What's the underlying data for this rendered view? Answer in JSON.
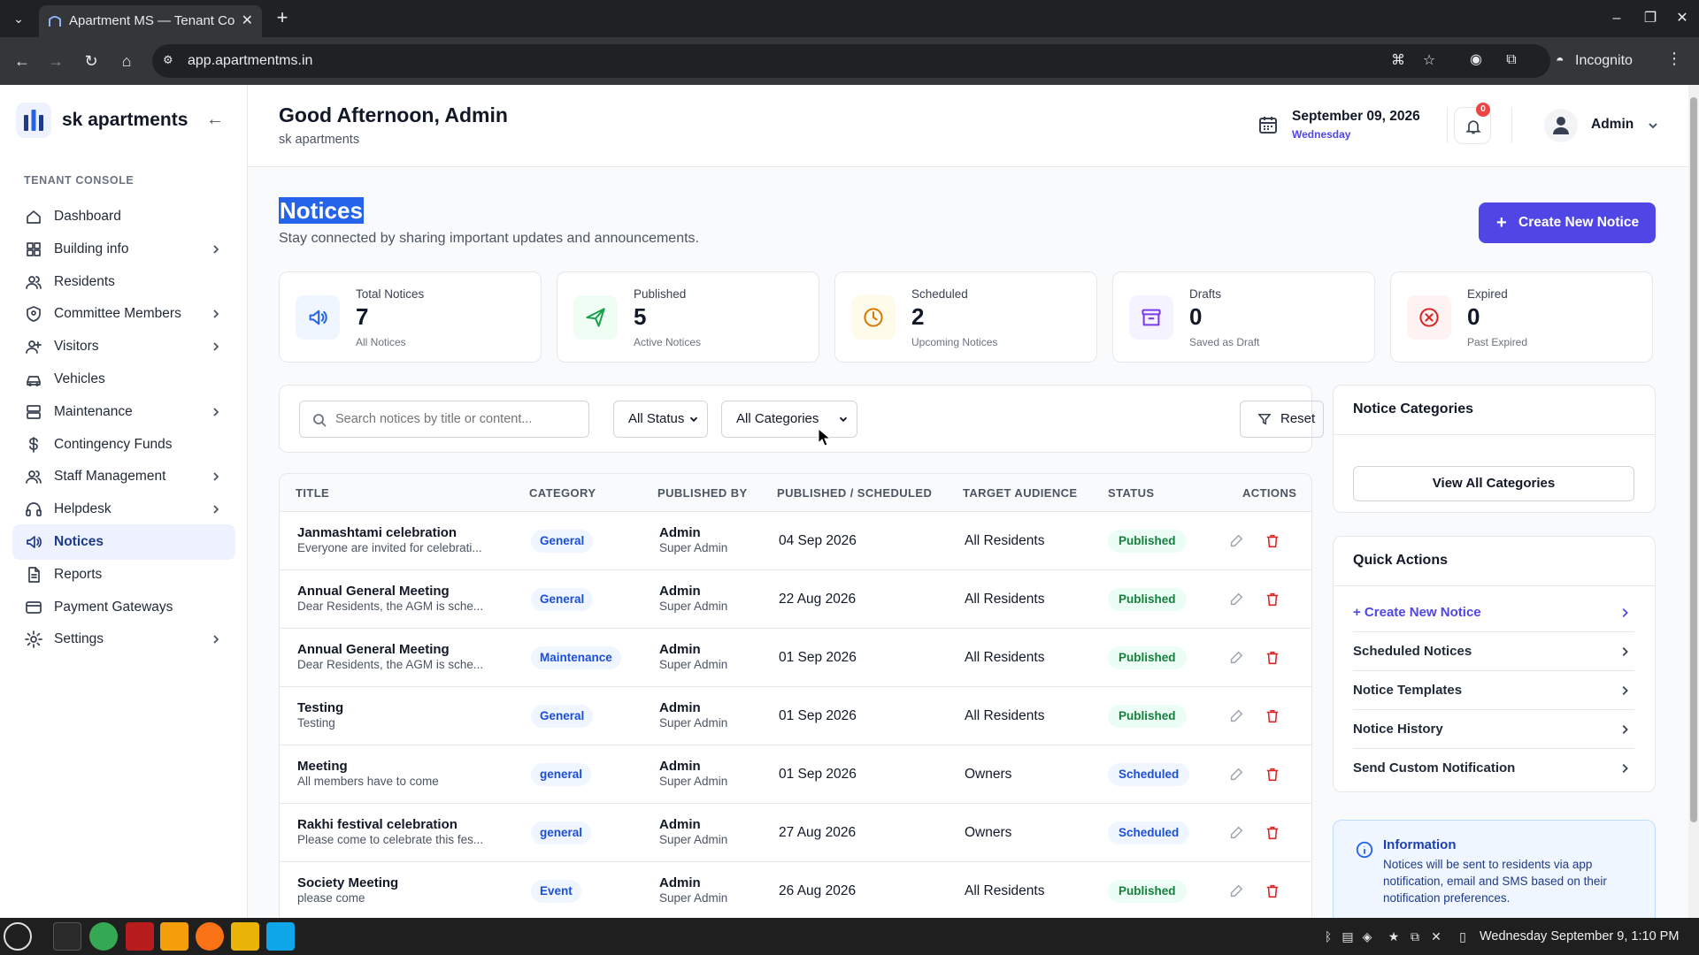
{
  "browser": {
    "tab_title": "Apartment MS — Tenant Co",
    "url": "app.apartmentms.in",
    "profile_label": "Incognito"
  },
  "sidebar": {
    "brand": "sk apartments",
    "section_label": "TENANT CONSOLE",
    "items": [
      {
        "label": "Dashboard",
        "icon": "home-icon",
        "has_submenu": false,
        "active": false
      },
      {
        "label": "Building info",
        "icon": "grid-icon",
        "has_submenu": true,
        "active": false
      },
      {
        "label": "Residents",
        "icon": "users-icon",
        "has_submenu": false,
        "active": false
      },
      {
        "label": "Committee Members",
        "icon": "shield-icon",
        "has_submenu": true,
        "active": false
      },
      {
        "label": "Visitors",
        "icon": "user-plus-icon",
        "has_submenu": true,
        "active": false
      },
      {
        "label": "Vehicles",
        "icon": "car-icon",
        "has_submenu": false,
        "active": false
      },
      {
        "label": "Maintenance",
        "icon": "server-icon",
        "has_submenu": true,
        "active": false
      },
      {
        "label": "Contingency Funds",
        "icon": "dollar-icon",
        "has_submenu": false,
        "active": false
      },
      {
        "label": "Staff Management",
        "icon": "staff-icon",
        "has_submenu": true,
        "active": false
      },
      {
        "label": "Helpdesk",
        "icon": "headset-icon",
        "has_submenu": true,
        "active": false
      },
      {
        "label": "Notices",
        "icon": "megaphone-icon",
        "has_submenu": false,
        "active": true
      },
      {
        "label": "Reports",
        "icon": "file-icon",
        "has_submenu": false,
        "active": false
      },
      {
        "label": "Payment Gateways",
        "icon": "credit-card-icon",
        "has_submenu": false,
        "active": false
      },
      {
        "label": "Settings",
        "icon": "gear-icon",
        "has_submenu": true,
        "active": false
      }
    ]
  },
  "header": {
    "greeting": "Good Afternoon, Admin",
    "subtitle": "sk apartments",
    "date": "September 09, 2026",
    "weekday": "Wednesday",
    "notification_count": "0",
    "user": "Admin"
  },
  "page": {
    "title": "Notices",
    "subtitle": "Stay connected by sharing important updates and announcements.",
    "create_button": "Create New Notice"
  },
  "stats": [
    {
      "label": "Total Notices",
      "value": "7",
      "sub": "All Notices",
      "icon": "megaphone-icon",
      "color": "#2563eb",
      "bg": "#eff6ff"
    },
    {
      "label": "Published",
      "value": "5",
      "sub": "Active Notices",
      "icon": "send-icon",
      "color": "#16a34a",
      "bg": "#f0fdf4"
    },
    {
      "label": "Scheduled",
      "value": "2",
      "sub": "Upcoming Notices",
      "icon": "clock-icon",
      "color": "#d97706",
      "bg": "#fffbeb"
    },
    {
      "label": "Drafts",
      "value": "0",
      "sub": "Saved as Draft",
      "icon": "archive-icon",
      "color": "#7c3aed",
      "bg": "#f5f3ff"
    },
    {
      "label": "Expired",
      "value": "0",
      "sub": "Past Expired",
      "icon": "x-circle-icon",
      "color": "#dc2626",
      "bg": "#fef2f2"
    }
  ],
  "filters": {
    "search_placeholder": "Search notices by title or content...",
    "status_value": "All Status",
    "category_value": "All Categories",
    "reset_label": "Reset"
  },
  "table": {
    "columns": [
      "TITLE",
      "CATEGORY",
      "PUBLISHED BY",
      "PUBLISHED / SCHEDULED",
      "TARGET AUDIENCE",
      "STATUS",
      "ACTIONS"
    ],
    "rows": [
      {
        "title": "Janmashtami celebration",
        "excerpt": "Everyone are invited for celebrati...",
        "category": "General",
        "by": "Admin",
        "role": "Super Admin",
        "date": "04 Sep 2026",
        "audience": "All Residents",
        "status": "Published"
      },
      {
        "title": "Annual General Meeting",
        "excerpt": "Dear Residents, the AGM is sche...",
        "category": "General",
        "by": "Admin",
        "role": "Super Admin",
        "date": "22 Aug 2026",
        "audience": "All Residents",
        "status": "Published"
      },
      {
        "title": "Annual General Meeting",
        "excerpt": "Dear Residents, the AGM is sche...",
        "category": "Maintenance",
        "by": "Admin",
        "role": "Super Admin",
        "date": "01 Sep 2026",
        "audience": "All Residents",
        "status": "Published"
      },
      {
        "title": "Testing",
        "excerpt": "Testing",
        "category": "General",
        "by": "Admin",
        "role": "Super Admin",
        "date": "01 Sep 2026",
        "audience": "All Residents",
        "status": "Published"
      },
      {
        "title": "Meeting",
        "excerpt": "All members have to come",
        "category": "general",
        "by": "Admin",
        "role": "Super Admin",
        "date": "01 Sep 2026",
        "audience": "Owners",
        "status": "Scheduled"
      },
      {
        "title": "Rakhi festival celebration",
        "excerpt": "Please come to celebrate this fes...",
        "category": "general",
        "by": "Admin",
        "role": "Super Admin",
        "date": "27 Aug 2026",
        "audience": "Owners",
        "status": "Scheduled"
      },
      {
        "title": "Society Meeting",
        "excerpt": "please come",
        "category": "Event",
        "by": "Admin",
        "role": "Super Admin",
        "date": "26 Aug 2026",
        "audience": "All Residents",
        "status": "Published"
      }
    ]
  },
  "categories_panel": {
    "title": "Notice Categories",
    "view_all": "View All Categories"
  },
  "quick_actions": {
    "title": "Quick Actions",
    "items": [
      "+ Create New Notice",
      "Scheduled Notices",
      "Notice Templates",
      "Notice History",
      "Send Custom Notification"
    ]
  },
  "info": {
    "title": "Information",
    "text": "Notices will be sent to residents via app notification, email and SMS based on their notification preferences."
  },
  "taskbar": {
    "clock": "Wednesday September 9, 1:10 PM"
  },
  "colors": {
    "accent": "#4f46e5",
    "published": "#15803d",
    "scheduled": "#1d4ed8",
    "delete": "#dc2626"
  }
}
